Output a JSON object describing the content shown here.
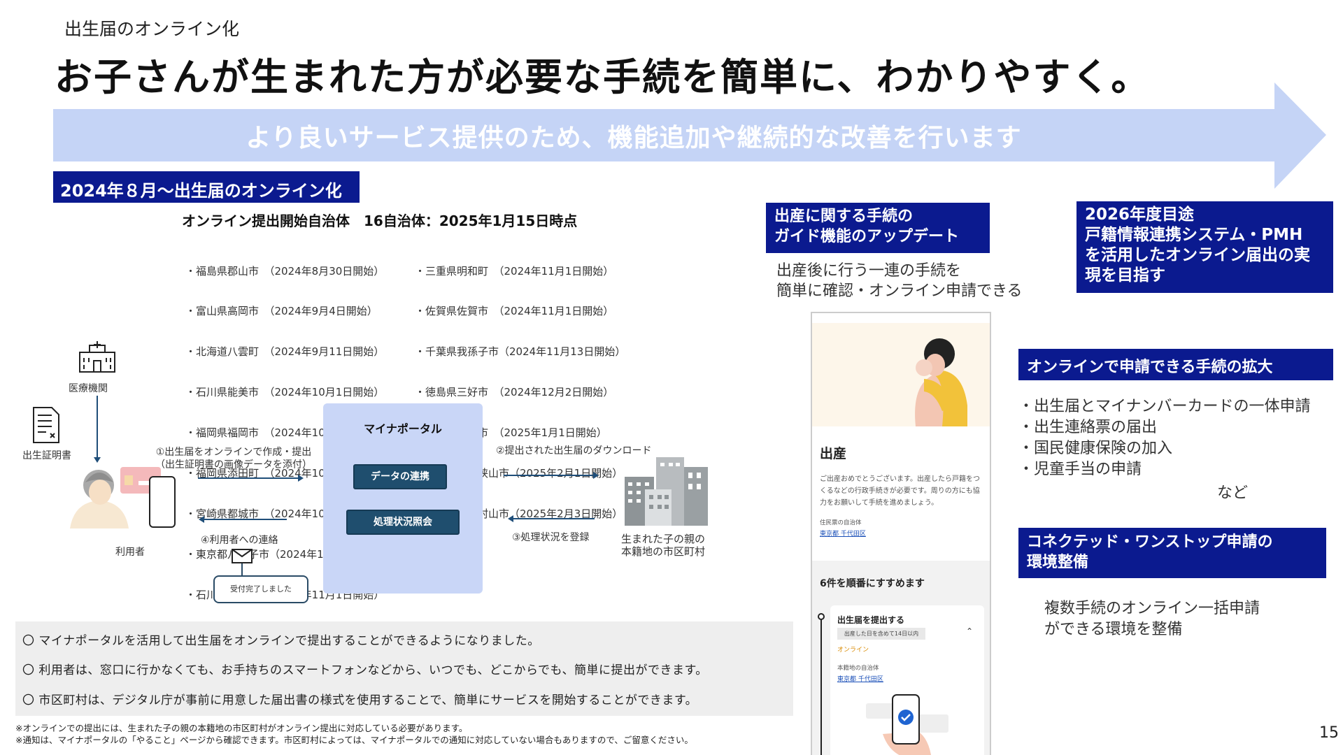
{
  "header": {
    "subtitle": "出生届のオンライン化",
    "title": "お子さんが生まれた方が必要な手続を簡単に、わかりやすく。"
  },
  "banner": {
    "text": "より良いサービス提供のため、機能追加や継続的な改善を行います",
    "color": "#c5d4f6"
  },
  "left_section": {
    "heading": "2024年８月～出生届のオンライン化",
    "muni_title": "オンライン提出開始自治体　16自治体：2025年1月15日時点",
    "muni_col1": [
      "・福島県郡山市　（2024年8月30日開始）",
      "・富山県高岡市　（2024年9月4日開始）",
      "・北海道八雲町　（2024年9月11日開始）",
      "・石川県能美市　（2024年10月1日開始）",
      "・福岡県福岡市　（2024年10月1日開始）",
      "・福岡県添田町　（2024年10月1日開始）",
      "・宮崎県都城市　（2024年10月10日開始）",
      "・東京都八王子市（2024年11月1日開始）",
      "・石川県加賀市　（2024年11月1日開始）"
    ],
    "muni_col2": [
      "・三重県明和町　（2024年11月1日開始）",
      "・佐賀県佐賀市　（2024年11月1日開始）",
      "・千葉県我孫子市（2024年11月13日開始）",
      "・徳島県三好市　（2024年12月2日開始）",
      "・群馬県渋川市　（2025年1月1日開始）",
      "・大阪府大阪狭山市（2025年2月1日開始）",
      "・東京都武蔵村山市（2025年2月3日開始）"
    ]
  },
  "diagram": {
    "hospital": "医療機関",
    "certificate": "出生証明書",
    "user": "利用者",
    "step1": "①出生届をオンラインで作成・提出\n（出生証明書の画像データを添付）",
    "step2": "②提出された出生届のダウンロード",
    "step3": "③処理状況を登録",
    "step4": "④利用者への連絡",
    "portal_title": "マイナポータル",
    "portal_btn1": "データの連携",
    "portal_btn2": "処理状況照会",
    "bubble": "受付完了しました",
    "city": "生まれた子の親の\n本籍地の市区町村"
  },
  "notes": [
    "〇 マイナポータルを活用して出生届をオンラインで提出することができるようになりました。",
    "〇 利用者は、窓口に行かなくても、お手持ちのスマートフォンなどから、いつでも、どこからでも、簡単に提出ができます。",
    "〇 市区町村は、デジタル庁が事前に用意した届出書の様式を使用することで、簡単にサービスを開始することができます。"
  ],
  "footnotes": [
    "※オンラインでの提出には、生まれた子の親の本籍地の市区町村がオンライン提出に対応している必要があります。",
    "※通知は、マイナポータルの「やること」ページから確認できます。市区町村によっては、マイナポータルでの通知に対応していない場合もありますので、ご留意ください。"
  ],
  "guide": {
    "heading": "出産に関する手続の\nガイド機能のアップデート",
    "desc": "出産後に行う一連の手続を\n簡単に確認・オンライン申請できる"
  },
  "phone": {
    "title": "出産",
    "body": "ご出産おめでとうございます。出産したら戸籍をつくるなどの行政手続きが必要です。周りの方にも協力をお願いして手続を進めましょう。",
    "residence_label": "住民票の自治体",
    "residence_link": "東京都 千代田区",
    "steps_title": "6件を順番にすすめます",
    "card_title": "出生届を提出する",
    "card_tag": "出産した日を含めて14日以内",
    "card_online": "オンライン",
    "registry_label": "本籍地の自治体",
    "registry_link": "東京都 千代田区"
  },
  "goal": {
    "heading": "2026年度目途\n戸籍情報連携システム・PMH\nを活用したオンライン届出の実\n現を目指す"
  },
  "expand": {
    "heading": "オンラインで申請できる手続の拡大",
    "items": [
      "・出生届とマイナンバーカードの一体申請",
      "・出生連絡票の届出",
      "・国民健康保険の加入",
      "・児童手当の申請"
    ],
    "nado": "など"
  },
  "connected": {
    "heading": "コネクテッド・ワンストップ申請の\n環境整備",
    "desc": "複数手続のオンライン一括申請\nができる環境を整備"
  },
  "page_number": "15",
  "colors": {
    "navy": "#0b1a8f",
    "portal": "#c9d6f7",
    "portal_button": "#1f4e6e"
  }
}
